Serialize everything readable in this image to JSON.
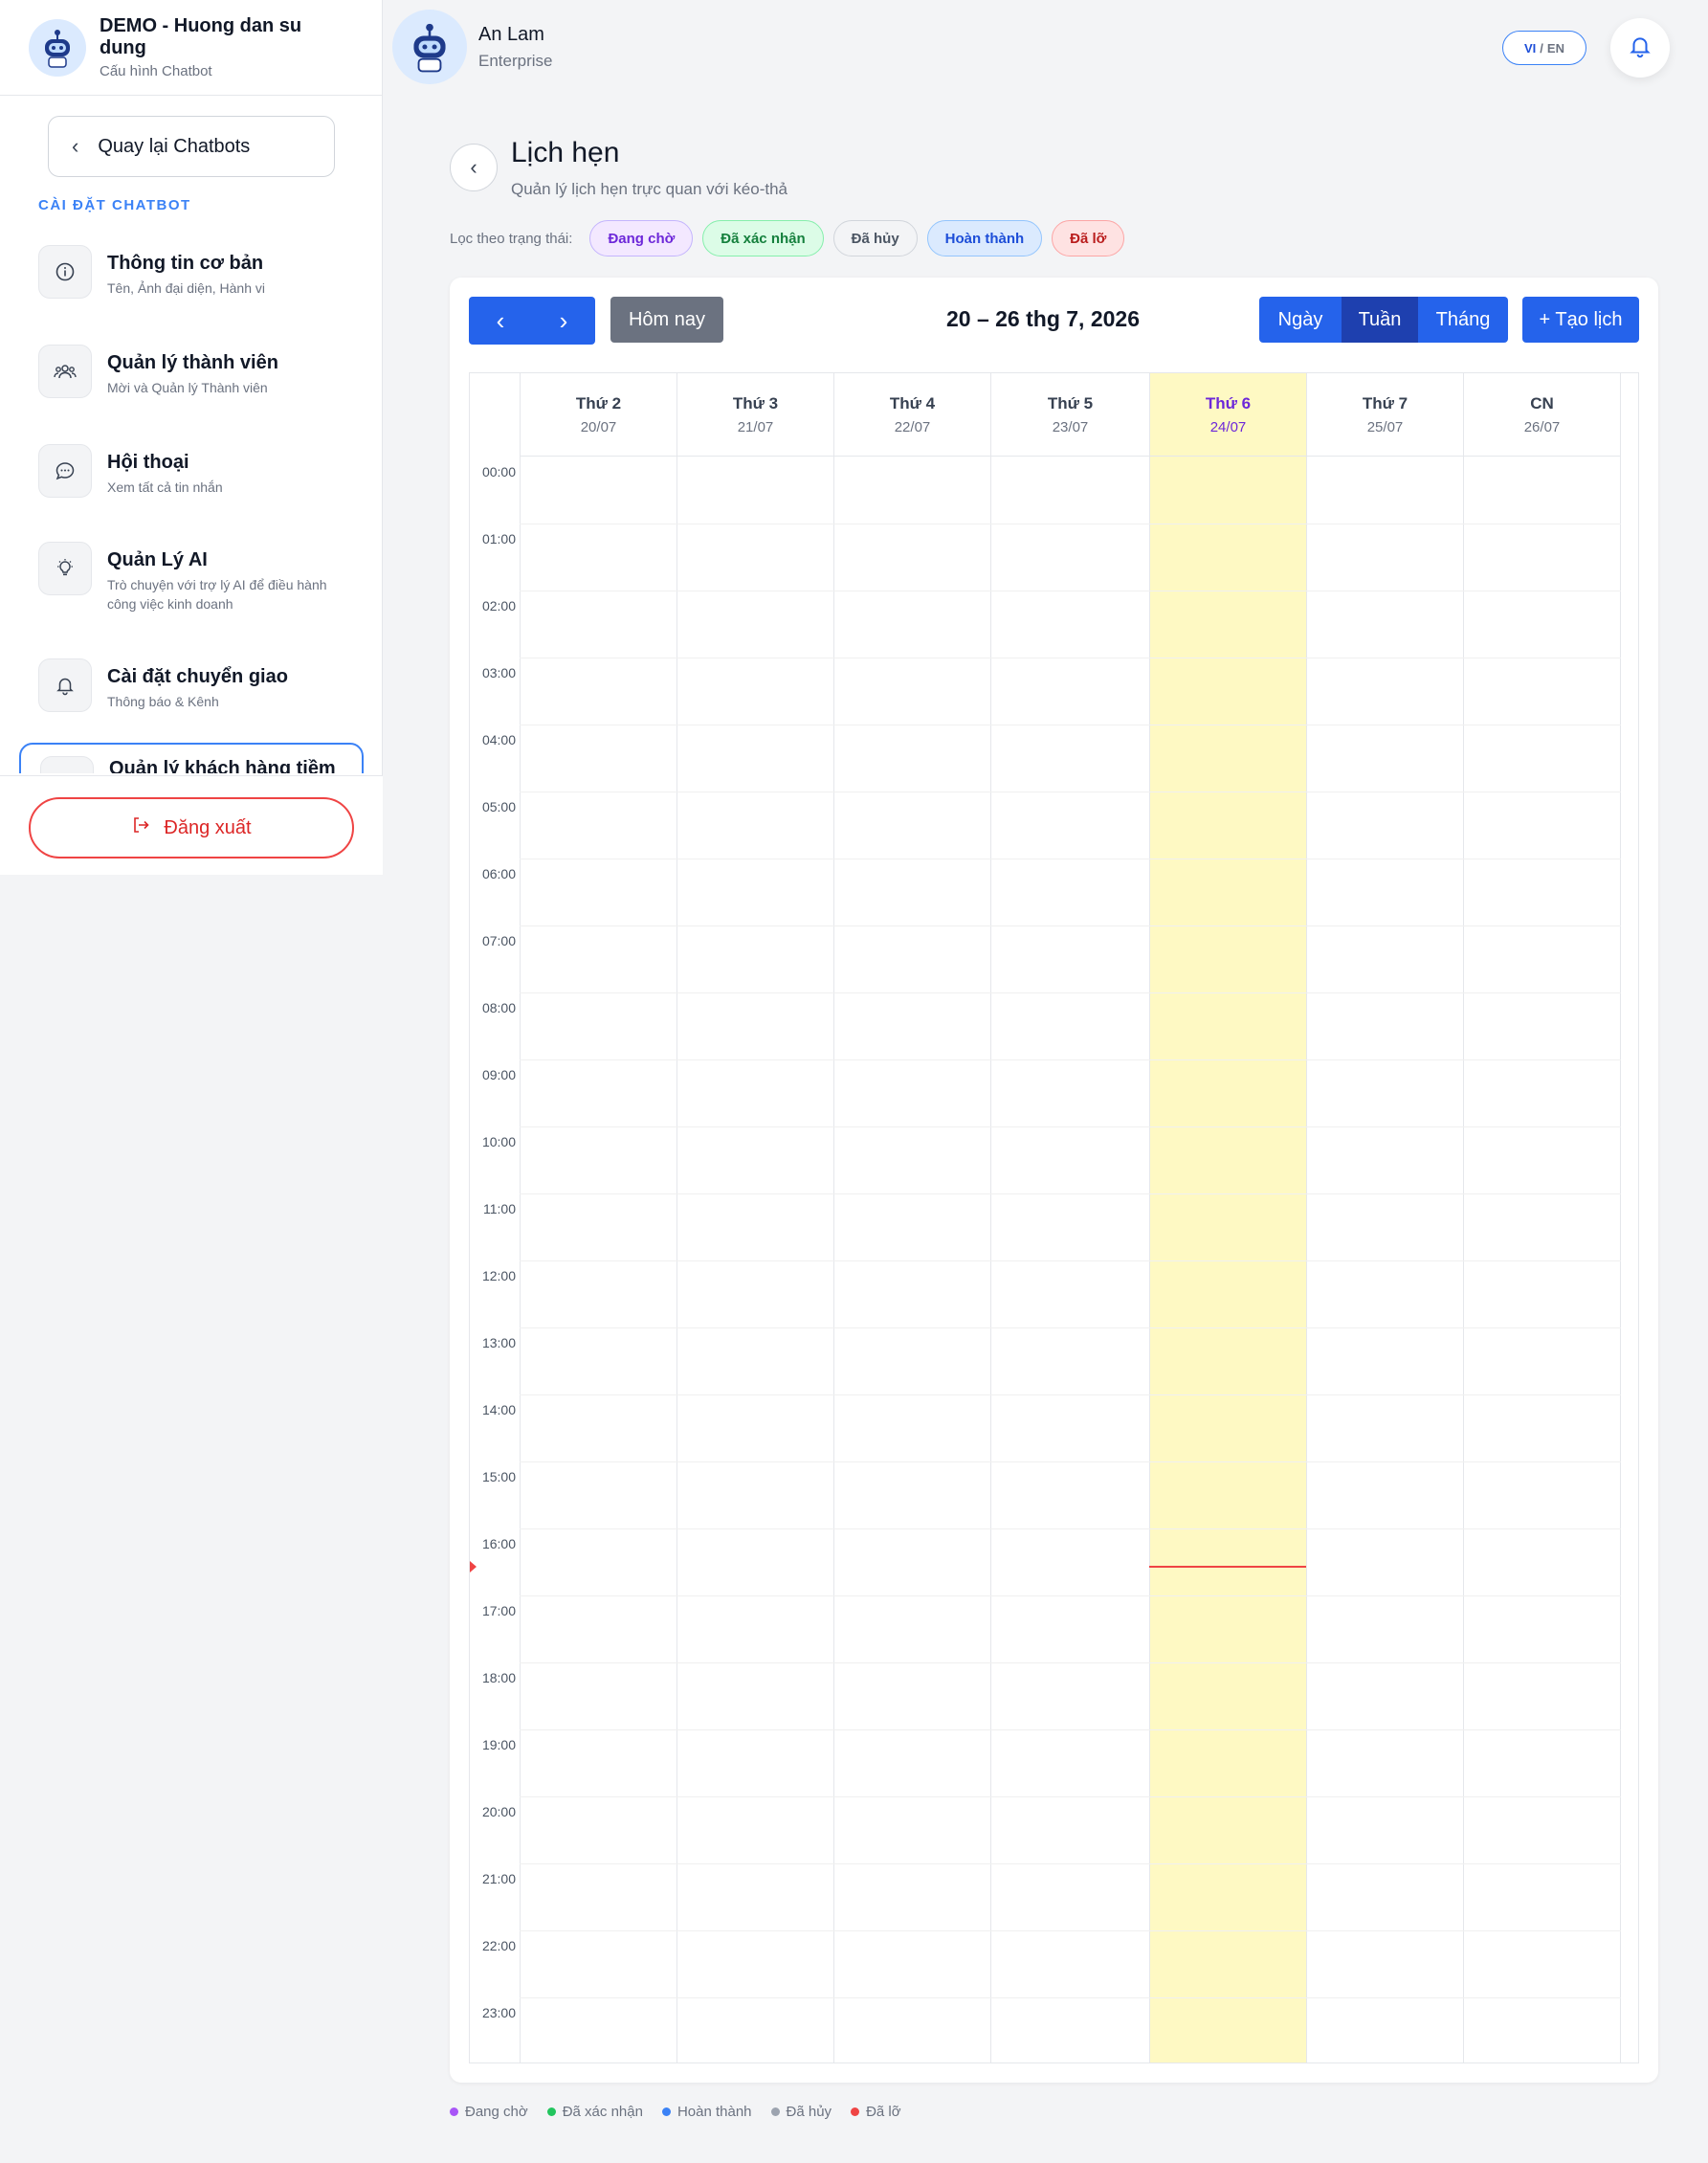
{
  "sidebar": {
    "bot_name": "DEMO - Huong dan su dung",
    "bot_sub": "Cấu hình Chatbot",
    "back_label": "Quay lại Chatbots",
    "section_label": "CÀI ĐẶT CHATBOT",
    "items": [
      {
        "title": "Thông tin cơ bản",
        "sub": "Tên, Ảnh đại diện, Hành vi",
        "icon": "info-icon"
      },
      {
        "title": "Quản lý thành viên",
        "sub": "Mời và Quản lý Thành viên",
        "icon": "users-icon"
      },
      {
        "title": "Hội thoại",
        "sub": "Xem tất cả tin nhắn",
        "icon": "chat-icon"
      },
      {
        "title": "Quản Lý AI",
        "sub": "Trò chuyện với trợ lý AI để điều hành công việc kinh doanh",
        "icon": "lightbulb-icon"
      },
      {
        "title": "Cài đặt chuyển giao",
        "sub": "Thông báo & Kênh",
        "icon": "bell-icon"
      },
      {
        "title": "Quản lý khách hàng tiềm",
        "sub": "",
        "icon": "leads-icon"
      }
    ],
    "logout_label": "Đăng xuất"
  },
  "topbar": {
    "user_name": "An Lam",
    "user_plan": "Enterprise",
    "lang_vi": "VI",
    "lang_sep": "/",
    "lang_en": "EN"
  },
  "page": {
    "title": "Lịch hẹn",
    "subtitle": "Quản lý lịch hẹn trực quan với kéo-thả",
    "filter_label": "Lọc theo trạng thái:",
    "filters": [
      "Đang chờ",
      "Đã xác nhận",
      "Đã hủy",
      "Hoàn thành",
      "Đã lỡ"
    ]
  },
  "calendar": {
    "today_label": "Hôm nay",
    "range": "20 – 26 thg 7, 2026",
    "views": [
      "Ngày",
      "Tuần",
      "Tháng"
    ],
    "active_view": "Tuần",
    "create_label": "+ Tạo lịch",
    "days": [
      {
        "name": "Thứ 2",
        "date": "20/07"
      },
      {
        "name": "Thứ 3",
        "date": "21/07"
      },
      {
        "name": "Thứ 4",
        "date": "22/07"
      },
      {
        "name": "Thứ 5",
        "date": "23/07"
      },
      {
        "name": "Thứ 6",
        "date": "24/07",
        "today": true
      },
      {
        "name": "Thứ 7",
        "date": "25/07"
      },
      {
        "name": "CN",
        "date": "26/07"
      }
    ],
    "hours": [
      "00:00",
      "01:00",
      "02:00",
      "03:00",
      "04:00",
      "05:00",
      "06:00",
      "07:00",
      "08:00",
      "09:00",
      "10:00",
      "11:00",
      "12:00",
      "13:00",
      "14:00",
      "15:00",
      "16:00",
      "17:00",
      "18:00",
      "19:00",
      "20:00",
      "21:00",
      "22:00",
      "23:00"
    ]
  },
  "legend": [
    {
      "label": "Đang chờ",
      "color": "#a855f7"
    },
    {
      "label": "Đã xác nhận",
      "color": "#22c55e"
    },
    {
      "label": "Hoàn thành",
      "color": "#3b82f6"
    },
    {
      "label": "Đã hủy",
      "color": "#9ca3af"
    },
    {
      "label": "Đã lỡ",
      "color": "#ef4444"
    }
  ],
  "colors": {
    "accent": "#2563eb",
    "accent_dark": "#1e40af",
    "today_bg": "#fef9c3",
    "now_line": "#ef4444"
  }
}
